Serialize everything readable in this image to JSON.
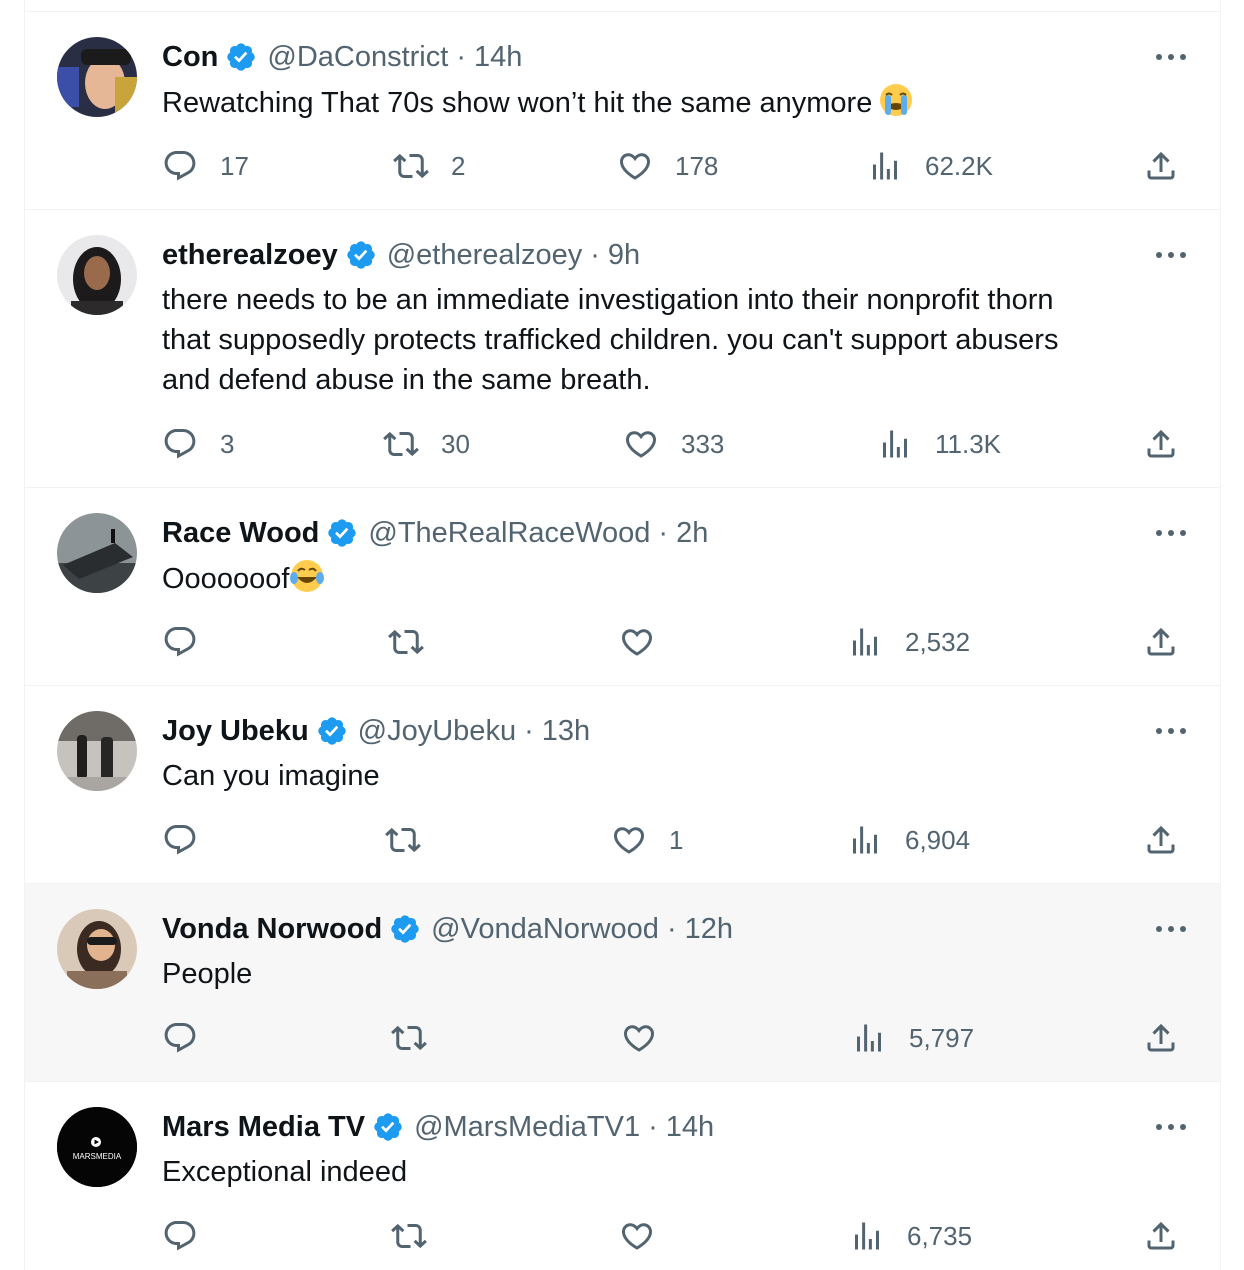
{
  "tweets": [
    {
      "name": "Con",
      "handle": "@DaConstrict",
      "separator": "·",
      "time": "14h",
      "text": "Rewatching That 70s show won’t hit the same anymore",
      "emoji": "loudly-crying-face",
      "replies": "17",
      "reposts": "2",
      "likes": "178",
      "views": "62.2K"
    },
    {
      "name": "etherealzoey",
      "handle": "@etherealzoey",
      "separator": "·",
      "time": "9h",
      "text_lines": [
        "there needs to be an immediate investigation into their nonprofit thorn",
        "that supposedly protects trafficked children. you can't support abusers",
        "and defend abuse in the same breath."
      ],
      "replies": "3",
      "reposts": "30",
      "likes": "333",
      "views": "11.3K"
    },
    {
      "name": "Race Wood",
      "handle": "@TheRealRaceWood",
      "separator": "·",
      "time": "2h",
      "text": "Ooooooof",
      "emoji": "face-with-tears-of-joy",
      "replies": "",
      "reposts": "",
      "likes": "",
      "views": "2,532"
    },
    {
      "name": "Joy Ubeku",
      "handle": "@JoyUbeku",
      "separator": "·",
      "time": "13h",
      "text": "Can you imagine",
      "replies": "",
      "reposts": "",
      "likes": "1",
      "views": "6,904"
    },
    {
      "name": "Vonda Norwood",
      "handle": "@VondaNorwood",
      "separator": "·",
      "time": "12h",
      "text": "People",
      "replies": "",
      "reposts": "",
      "likes": "",
      "views": "5,797"
    },
    {
      "name": "Mars Media TV",
      "handle": "@MarsMediaTV1",
      "separator": "·",
      "time": "14h",
      "text": "Exceptional indeed",
      "avatar_logo_text": "MARSMEDIA",
      "replies": "",
      "reposts": "",
      "likes": "",
      "views": "6,735"
    }
  ],
  "icons": {
    "reply": "reply-icon",
    "repost": "repost-icon",
    "like": "heart-icon",
    "views": "views-icon",
    "share": "share-icon",
    "verified": "verified-badge-icon",
    "more": "more-icon"
  },
  "colors": {
    "verified_blue": "#1d9bf0",
    "text_primary": "#0f1419",
    "text_secondary": "#536471",
    "divider": "#eff3f4",
    "hover_row": "#f7f7f7"
  }
}
